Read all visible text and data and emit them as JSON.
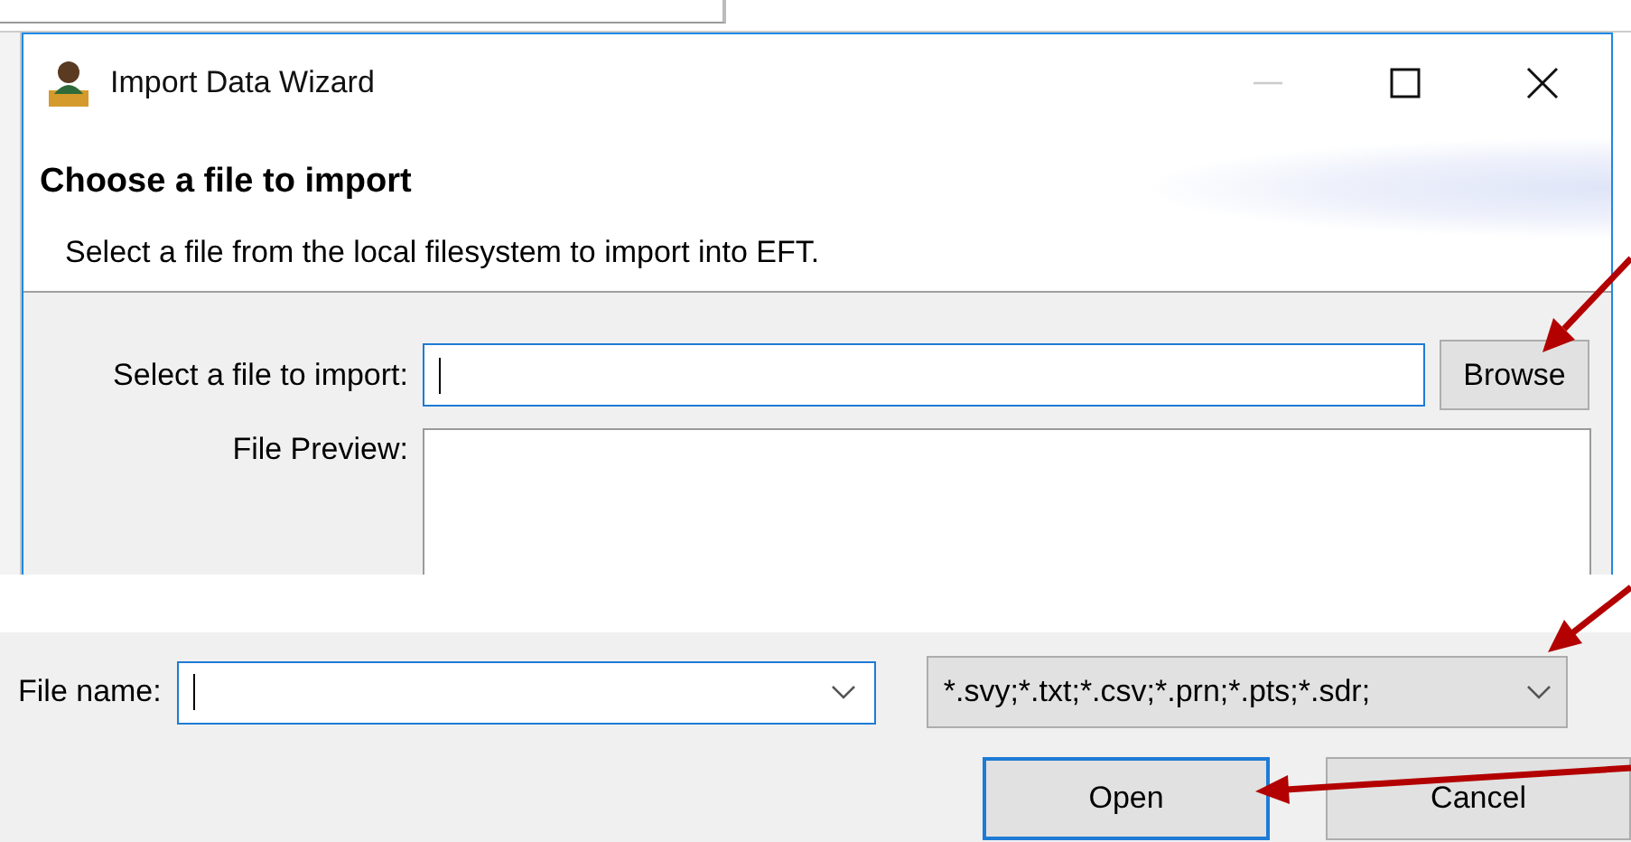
{
  "window": {
    "title": "Import Data Wizard"
  },
  "header": {
    "title": "Choose a file to import",
    "description": "Select a file from the local filesystem to import into EFT."
  },
  "form": {
    "file_label": "Select a file to import:",
    "file_field": {
      "focused": true
    },
    "browse_button": "Browse",
    "preview_label": "File Preview:"
  },
  "file_dialog": {
    "file_name_label": "File name:",
    "file_name_field": {
      "focused": true
    },
    "filter": "*.svy;*.txt;*.csv;*.prn;*.pts;*.sdr;",
    "buttons": [
      {
        "label": "Open",
        "default": true
      },
      {
        "label": "Cancel",
        "default": false
      }
    ]
  }
}
